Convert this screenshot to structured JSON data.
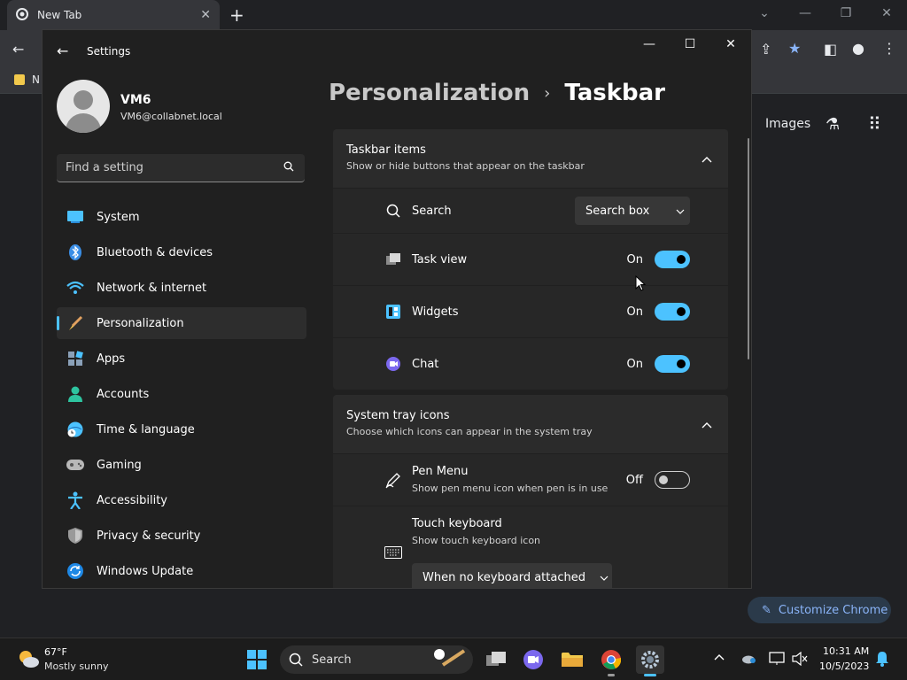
{
  "browser": {
    "tab_title": "New Tab",
    "bookmark_label": "N",
    "images_link": "Images",
    "customize_label": "Customize Chrome"
  },
  "window": {
    "app_title": "Settings"
  },
  "user": {
    "name": "VM6",
    "email": "VM6@collabnet.local"
  },
  "search": {
    "placeholder": "Find a setting"
  },
  "nav": {
    "items": [
      {
        "label": "System"
      },
      {
        "label": "Bluetooth & devices"
      },
      {
        "label": "Network & internet"
      },
      {
        "label": "Personalization",
        "active": true
      },
      {
        "label": "Apps"
      },
      {
        "label": "Accounts"
      },
      {
        "label": "Time & language"
      },
      {
        "label": "Gaming"
      },
      {
        "label": "Accessibility"
      },
      {
        "label": "Privacy & security"
      },
      {
        "label": "Windows Update"
      }
    ]
  },
  "breadcrumb": {
    "parent": "Personalization",
    "separator": "›",
    "current": "Taskbar"
  },
  "taskbar_items": {
    "title": "Taskbar items",
    "subtitle": "Show or hide buttons that appear on the taskbar",
    "search_label": "Search",
    "search_value": "Search box",
    "task_view_label": "Task view",
    "task_view_state": "On",
    "widgets_label": "Widgets",
    "widgets_state": "On",
    "chat_label": "Chat",
    "chat_state": "On"
  },
  "system_tray": {
    "title": "System tray icons",
    "subtitle": "Choose which icons can appear in the system tray",
    "pen_menu_label": "Pen Menu",
    "pen_menu_sub": "Show pen menu icon when pen is in use",
    "pen_menu_state": "Off",
    "touch_kb_label": "Touch keyboard",
    "touch_kb_sub": "Show touch keyboard icon",
    "touch_kb_value": "When no keyboard attached"
  },
  "taskbar": {
    "weather_temp": "67°F",
    "weather_cond": "Mostly sunny",
    "search_label": "Search",
    "time": "10:31 AM",
    "date": "10/5/2023"
  },
  "colors": {
    "accent": "#4cc2ff",
    "window_bg": "#202020",
    "card_bg": "#2b2b2b"
  }
}
